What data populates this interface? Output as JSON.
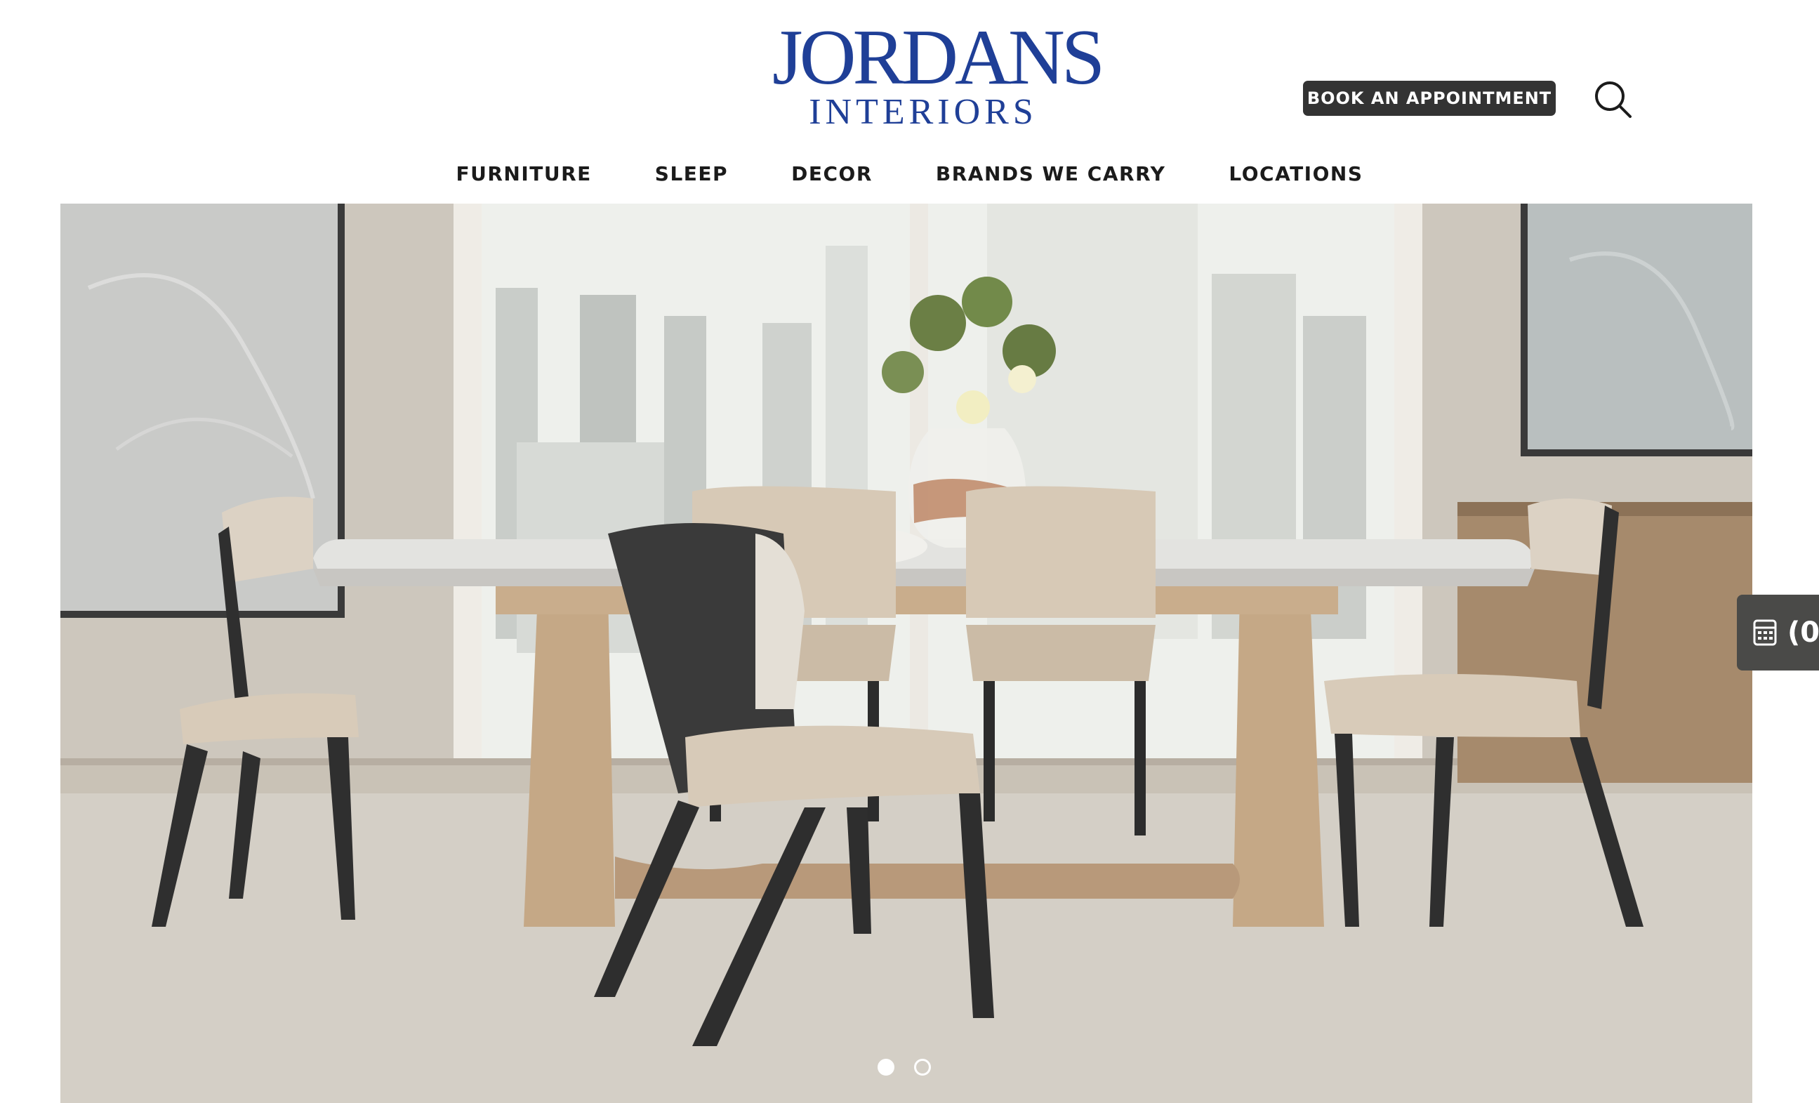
{
  "brand": {
    "name_top": "JORDANS",
    "name_bottom": "INTERIORS",
    "color": "#1f3f97"
  },
  "header": {
    "cta_label": "BOOK AN APPOINTMENT",
    "search_icon": "search-icon"
  },
  "nav": {
    "items": [
      {
        "label": "FURNITURE"
      },
      {
        "label": "SLEEP"
      },
      {
        "label": "DECOR"
      },
      {
        "label": "BRANDS WE CARRY"
      },
      {
        "label": "LOCATIONS"
      }
    ]
  },
  "hero": {
    "slide_count": 2,
    "active_slide": 1
  },
  "side_tab": {
    "icon": "calculator-icon",
    "text": "(0"
  }
}
